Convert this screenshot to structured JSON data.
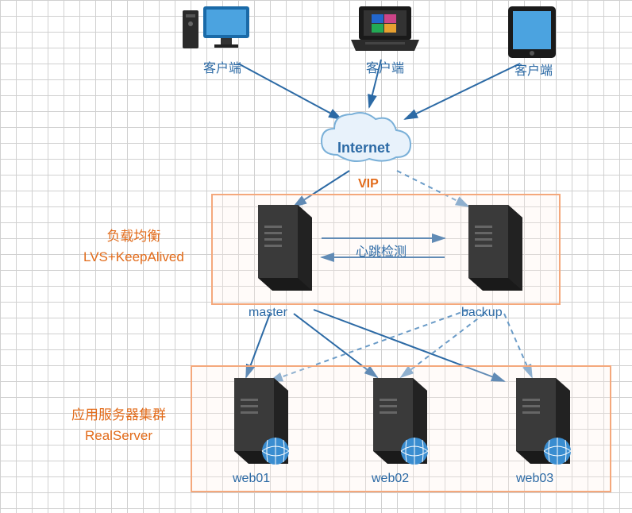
{
  "clients": {
    "desktop": {
      "label": "客户端"
    },
    "laptop": {
      "label": "客户端"
    },
    "tablet": {
      "label": "客户端"
    }
  },
  "internet": {
    "label": "Internet"
  },
  "vip": {
    "label": "VIP"
  },
  "load_balancer": {
    "title_line1": "负载均衡",
    "title_line2": "LVS+KeepAlived",
    "master": {
      "label": "master"
    },
    "backup": {
      "label": "backup"
    },
    "heartbeat": "心跳检测"
  },
  "real_server": {
    "title_line1": "应用服务器集群",
    "title_line2": "RealServer",
    "web01": {
      "label": "web01"
    },
    "web02": {
      "label": "web02"
    },
    "web03": {
      "label": "web03"
    }
  },
  "colors": {
    "line_solid": "#2c6aa5",
    "line_dashed": "#6a9bc7",
    "box_border": "#f4a87c",
    "text_blue": "#2c6aa5",
    "text_orange": "#e26b1a"
  }
}
